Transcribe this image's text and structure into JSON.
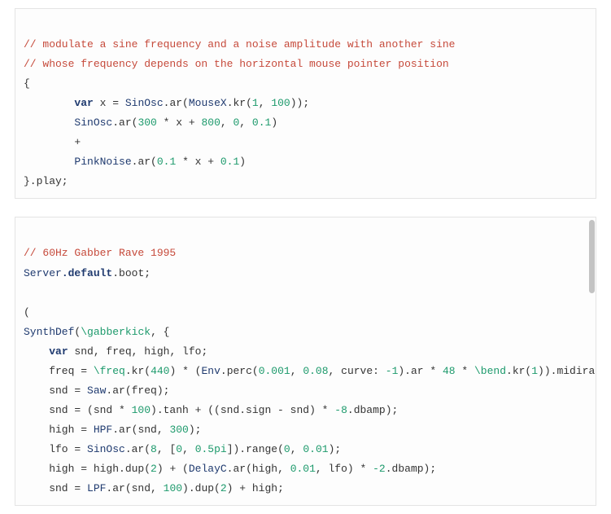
{
  "block1": {
    "line1": "// modulate a sine frequency and a noise amplitude with another sine",
    "line2": "// whose frequency depends on the horizontal mouse pointer position",
    "l3_open": "{",
    "l4_var": "var",
    "l4_x": " x = ",
    "l4_sinosc": "SinOsc",
    "l4_ar": ".ar(",
    "l4_mousex": "MouseX",
    "l4_kr": ".kr(",
    "l4_n1": "1",
    "l4_c": ", ",
    "l4_n2": "100",
    "l4_close": "));",
    "l5_sinosc": "SinOsc",
    "l5_ar": ".ar(",
    "l5_n1": "300",
    "l5_mid": " * x + ",
    "l5_n2": "800",
    "l5_c1": ", ",
    "l5_n3": "0",
    "l5_c2": ", ",
    "l5_n4": "0.1",
    "l5_close": ")",
    "l6_plus": "+",
    "l7_pn": "PinkNoise",
    "l7_ar": ".ar(",
    "l7_n1": "0.1",
    "l7_mid": " * x + ",
    "l7_n2": "0.1",
    "l7_close": ")",
    "l8_close": "}.play;"
  },
  "block2": {
    "line1": "// 60Hz Gabber Rave 1995",
    "l2_server": "Server",
    "l2_def": ".default",
    "l2_boot": ".boot;",
    "l4_open": "(",
    "l5_sd": "SynthDef",
    "l5_open": "(",
    "l5_sym": "\\gabberkick",
    "l5_rest": ", {",
    "l6_var": "var",
    "l6_rest": " snd, freq, high, lfo;",
    "l7_a": "    freq = ",
    "l7_sym": "\\freq",
    "l7_kr": ".kr(",
    "l7_n1": "440",
    "l7_b": ") * (",
    "l7_env": "Env",
    "l7_perc": ".perc(",
    "l7_n2": "0.001",
    "l7_c1": ", ",
    "l7_n3": "0.08",
    "l7_c2": ", curve: ",
    "l7_n4": "-1",
    "l7_d": ").ar * ",
    "l7_n5": "48",
    "l7_e": " * ",
    "l7_sym2": "\\bend",
    "l7_kr2": ".kr(",
    "l7_n6": "1",
    "l7_f": ")).midiratio;",
    "l8_a": "    snd = ",
    "l8_saw": "Saw",
    "l8_b": ".ar(freq);",
    "l9_a": "    snd = (snd * ",
    "l9_n1": "100",
    "l9_b": ").tanh + ((snd.sign - snd) * ",
    "l9_n2": "-8",
    "l9_c": ".dbamp);",
    "l10_a": "    high = ",
    "l10_hpf": "HPF",
    "l10_b": ".ar(snd, ",
    "l10_n1": "300",
    "l10_c": ");",
    "l11_a": "    lfo = ",
    "l11_sin": "SinOsc",
    "l11_b": ".ar(",
    "l11_n1": "8",
    "l11_c": ", [",
    "l11_n2": "0",
    "l11_d": ", ",
    "l11_n3": "0.5pi",
    "l11_e": "]).range(",
    "l11_n4": "0",
    "l11_f": ", ",
    "l11_n5": "0.01",
    "l11_g": ");",
    "l12_a": "    high = high.dup(",
    "l12_n1": "2",
    "l12_b": ") + (",
    "l12_dc": "DelayC",
    "l12_c": ".ar(high, ",
    "l12_n2": "0.01",
    "l12_d": ", lfo) * ",
    "l12_n3": "-2",
    "l12_e": ".dbamp);",
    "l13_a": "    snd = ",
    "l13_lpf": "LPF",
    "l13_b": ".ar(snd, ",
    "l13_n1": "100",
    "l13_c": ").dup(",
    "l13_n2": "2",
    "l13_d": ") + high;"
  }
}
